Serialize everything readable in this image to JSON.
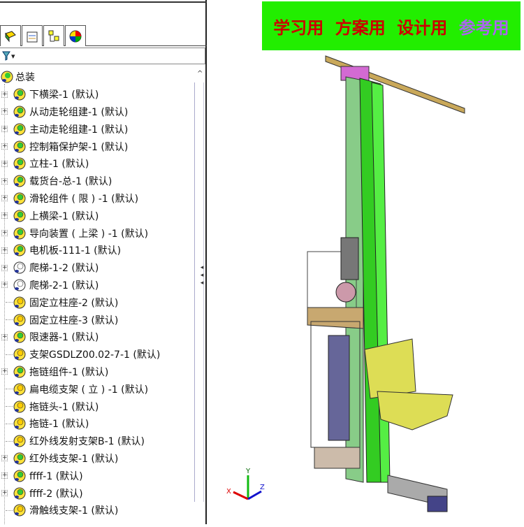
{
  "tabs": [
    {
      "name": "feature-manager-tab"
    },
    {
      "name": "property-manager-tab"
    },
    {
      "name": "configuration-manager-tab"
    },
    {
      "name": "appearance-tab"
    }
  ],
  "filter": {
    "icon": "filter-icon",
    "arrow": "▾"
  },
  "tree": {
    "root": "总装",
    "items": [
      {
        "label": "下横梁-1 (默认)",
        "exp": true,
        "c": "g"
      },
      {
        "label": "从动走轮组建-1 (默认)",
        "exp": true,
        "c": "g"
      },
      {
        "label": "主动走轮组建-1 (默认)",
        "exp": true,
        "c": "g"
      },
      {
        "label": "控制箱保护架-1 (默认)",
        "exp": true,
        "c": "g"
      },
      {
        "label": "立柱-1 (默认)",
        "exp": true,
        "c": "g"
      },
      {
        "label": "载货台-总-1 (默认)",
        "exp": true,
        "c": "g"
      },
      {
        "label": "滑轮组件 ( 限 ) -1 (默认)",
        "exp": true,
        "c": "g"
      },
      {
        "label": "上横梁-1 (默认)",
        "exp": true,
        "c": "g"
      },
      {
        "label": "导向装置 ( 上梁 ) -1 (默认)",
        "exp": true,
        "c": "g"
      },
      {
        "label": "电机板-111-1 (默认)",
        "exp": true,
        "c": "g"
      },
      {
        "label": "爬梯-1-2 (默认)",
        "exp": true,
        "c": "w"
      },
      {
        "label": "爬梯-2-1 (默认)",
        "exp": true,
        "c": "w"
      },
      {
        "label": "固定立柱座-2 (默认)",
        "exp": false,
        "c": "y"
      },
      {
        "label": "固定立柱座-3 (默认)",
        "exp": false,
        "c": "y"
      },
      {
        "label": "限速器-1 (默认)",
        "exp": true,
        "c": "g"
      },
      {
        "label": "支架GSDLZ00.02-7-1 (默认)",
        "exp": false,
        "c": "y"
      },
      {
        "label": "拖链组件-1 (默认)",
        "exp": true,
        "c": "g"
      },
      {
        "label": "扁电缆支架 ( 立 ) -1 (默认)",
        "exp": false,
        "c": "y"
      },
      {
        "label": "拖链头-1 (默认)",
        "exp": false,
        "c": "y"
      },
      {
        "label": "拖链-1 (默认)",
        "exp": false,
        "c": "y"
      },
      {
        "label": "红外线发射支架B-1 (默认)",
        "exp": false,
        "c": "y"
      },
      {
        "label": "红外线支架-1 (默认)",
        "exp": true,
        "c": "g"
      },
      {
        "label": "ffff-1 (默认)",
        "exp": true,
        "c": "g"
      },
      {
        "label": "ffff-2 (默认)",
        "exp": true,
        "c": "g"
      },
      {
        "label": "滑触线支架-1 (默认)",
        "exp": false,
        "c": "y"
      }
    ]
  },
  "banner": {
    "items": [
      {
        "text": "学习用",
        "color": "#cc0000"
      },
      {
        "text": "方案用",
        "color": "#cc0000"
      },
      {
        "text": "设计用",
        "color": "#cc0000"
      },
      {
        "text": "参考用",
        "color": "#aa66ee"
      }
    ]
  },
  "triad": {
    "x": "X",
    "y": "Y",
    "z": "Z"
  }
}
